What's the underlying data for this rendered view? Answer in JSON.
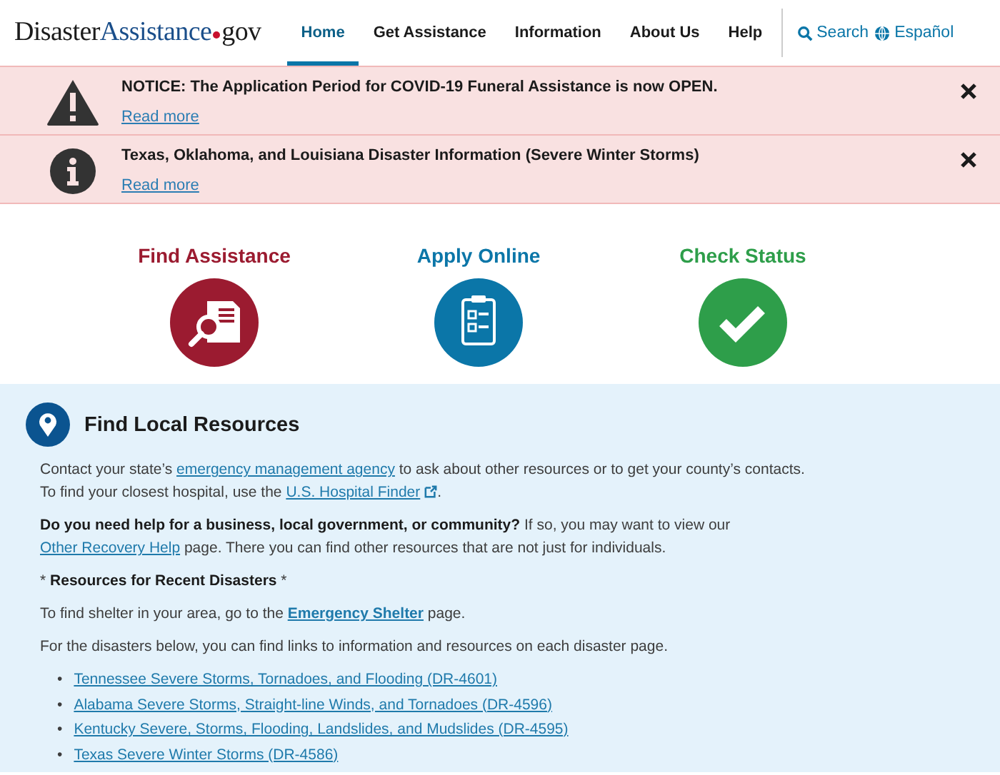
{
  "logo": {
    "first": "Disaster",
    "second": "Assistance",
    "third": "gov"
  },
  "nav": [
    {
      "label": "Home",
      "selected": true
    },
    {
      "label": "Get Assistance",
      "selected": false
    },
    {
      "label": "Information",
      "selected": false
    },
    {
      "label": "About Us",
      "selected": false
    },
    {
      "label": "Help",
      "selected": false
    }
  ],
  "utility": [
    {
      "kind": "search",
      "label": "Search"
    },
    {
      "kind": "language",
      "label": "Español"
    }
  ],
  "alerts": [
    {
      "kind": "warning",
      "text": "NOTICE: The Application Period for COVID-19 Funeral Assistance is now OPEN.",
      "link": "Read more"
    },
    {
      "kind": "info",
      "text": "Texas, Oklahoma, and Louisiana Disaster Information (Severe Winter Storms)",
      "link": "Read more"
    }
  ],
  "actions": [
    {
      "kind": "find",
      "title": "Find Assistance",
      "color": "#9b1b30"
    },
    {
      "kind": "apply",
      "title": "Apply Online",
      "color": "#0b76a8"
    },
    {
      "kind": "status",
      "title": "Check Status",
      "color": "#2e9e4a"
    }
  ],
  "resources": {
    "title": "Find Local Resources",
    "paragraphs": [
      [
        {
          "kind": "text",
          "text": "Contact your state’s "
        },
        {
          "kind": "link",
          "text": "emergency management agency"
        },
        {
          "kind": "text",
          "text": " to ask about other resources or to get your county’s contacts."
        },
        {
          "kind": "break"
        },
        {
          "kind": "text",
          "text": "To find your closest hospital, use the "
        },
        {
          "kind": "external-link",
          "text": "U.S. Hospital Finder"
        },
        {
          "kind": "text",
          "text": "."
        }
      ],
      [
        {
          "kind": "bold",
          "text": "Do you need help for a business, local government, or community?"
        },
        {
          "kind": "text",
          "text": " If so, you may want to view our "
        },
        {
          "kind": "link",
          "text": "Other Recovery Help"
        },
        {
          "kind": "text",
          "text": " page. There you can find other resources that are not just for individuals."
        }
      ],
      [
        {
          "kind": "text",
          "text": "* "
        },
        {
          "kind": "bold",
          "text": "Resources for Recent Disasters"
        },
        {
          "kind": "text",
          "text": " *"
        }
      ],
      [
        {
          "kind": "text",
          "text": "To find shelter in your area, go to the "
        },
        {
          "kind": "bold-link",
          "text": "Emergency Shelter"
        },
        {
          "kind": "text",
          "text": " page."
        }
      ],
      [
        {
          "kind": "text",
          "text": "For the disasters below, you can find links to information and resources on each disaster page."
        }
      ]
    ],
    "disasters": [
      {
        "bullet": "•",
        "text": "Tennessee Severe Storms, Tornadoes, and Flooding (DR-4601)"
      },
      {
        "bullet": "•",
        "text": "Alabama Severe Storms, Straight-line Winds, and Tornadoes (DR-4596)"
      },
      {
        "bullet": "•",
        "text": "Kentucky Severe, Storms, Flooding, Landslides, and Mudslides (DR-4595)"
      },
      {
        "bullet": "•",
        "text": "Texas Severe Winter Storms (DR-4586)"
      }
    ]
  }
}
